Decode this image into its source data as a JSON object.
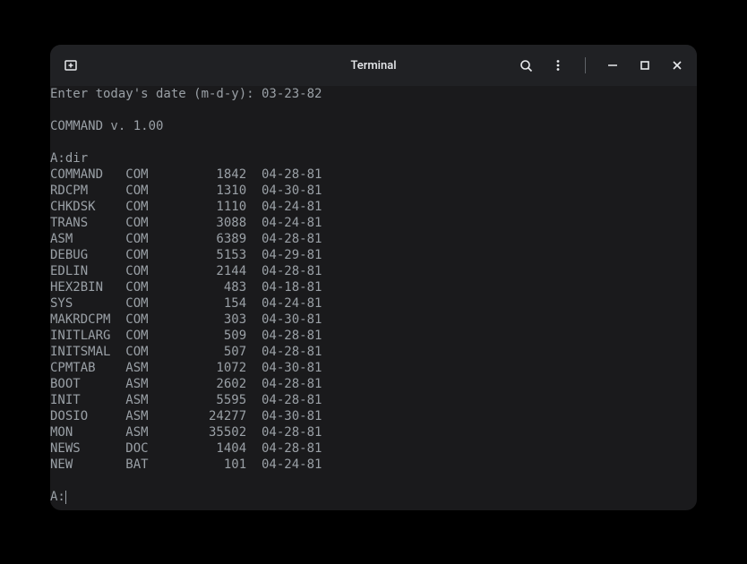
{
  "window": {
    "title": "Terminal"
  },
  "terminal": {
    "prompt_line": "Enter today's date (m-d-y): 03-23-82",
    "version_line": "COMMAND v. 1.00",
    "command_line": "A:dir",
    "files": [
      {
        "name": "COMMAND",
        "ext": "COM",
        "size": "1842",
        "date": "04-28-81"
      },
      {
        "name": "RDCPM",
        "ext": "COM",
        "size": "1310",
        "date": "04-30-81"
      },
      {
        "name": "CHKDSK",
        "ext": "COM",
        "size": "1110",
        "date": "04-24-81"
      },
      {
        "name": "TRANS",
        "ext": "COM",
        "size": "3088",
        "date": "04-24-81"
      },
      {
        "name": "ASM",
        "ext": "COM",
        "size": "6389",
        "date": "04-28-81"
      },
      {
        "name": "DEBUG",
        "ext": "COM",
        "size": "5153",
        "date": "04-29-81"
      },
      {
        "name": "EDLIN",
        "ext": "COM",
        "size": "2144",
        "date": "04-28-81"
      },
      {
        "name": "HEX2BIN",
        "ext": "COM",
        "size": "483",
        "date": "04-18-81"
      },
      {
        "name": "SYS",
        "ext": "COM",
        "size": "154",
        "date": "04-24-81"
      },
      {
        "name": "MAKRDCPM",
        "ext": "COM",
        "size": "303",
        "date": "04-30-81"
      },
      {
        "name": "INITLARG",
        "ext": "COM",
        "size": "509",
        "date": "04-28-81"
      },
      {
        "name": "INITSMAL",
        "ext": "COM",
        "size": "507",
        "date": "04-28-81"
      },
      {
        "name": "CPMTAB",
        "ext": "ASM",
        "size": "1072",
        "date": "04-30-81"
      },
      {
        "name": "BOOT",
        "ext": "ASM",
        "size": "2602",
        "date": "04-28-81"
      },
      {
        "name": "INIT",
        "ext": "ASM",
        "size": "5595",
        "date": "04-28-81"
      },
      {
        "name": "DOSIO",
        "ext": "ASM",
        "size": "24277",
        "date": "04-30-81"
      },
      {
        "name": "MON",
        "ext": "ASM",
        "size": "35502",
        "date": "04-28-81"
      },
      {
        "name": "NEWS",
        "ext": "DOC",
        "size": "1404",
        "date": "04-28-81"
      },
      {
        "name": "NEW",
        "ext": "BAT",
        "size": "101",
        "date": "04-24-81"
      }
    ],
    "current_prompt": "A:"
  }
}
